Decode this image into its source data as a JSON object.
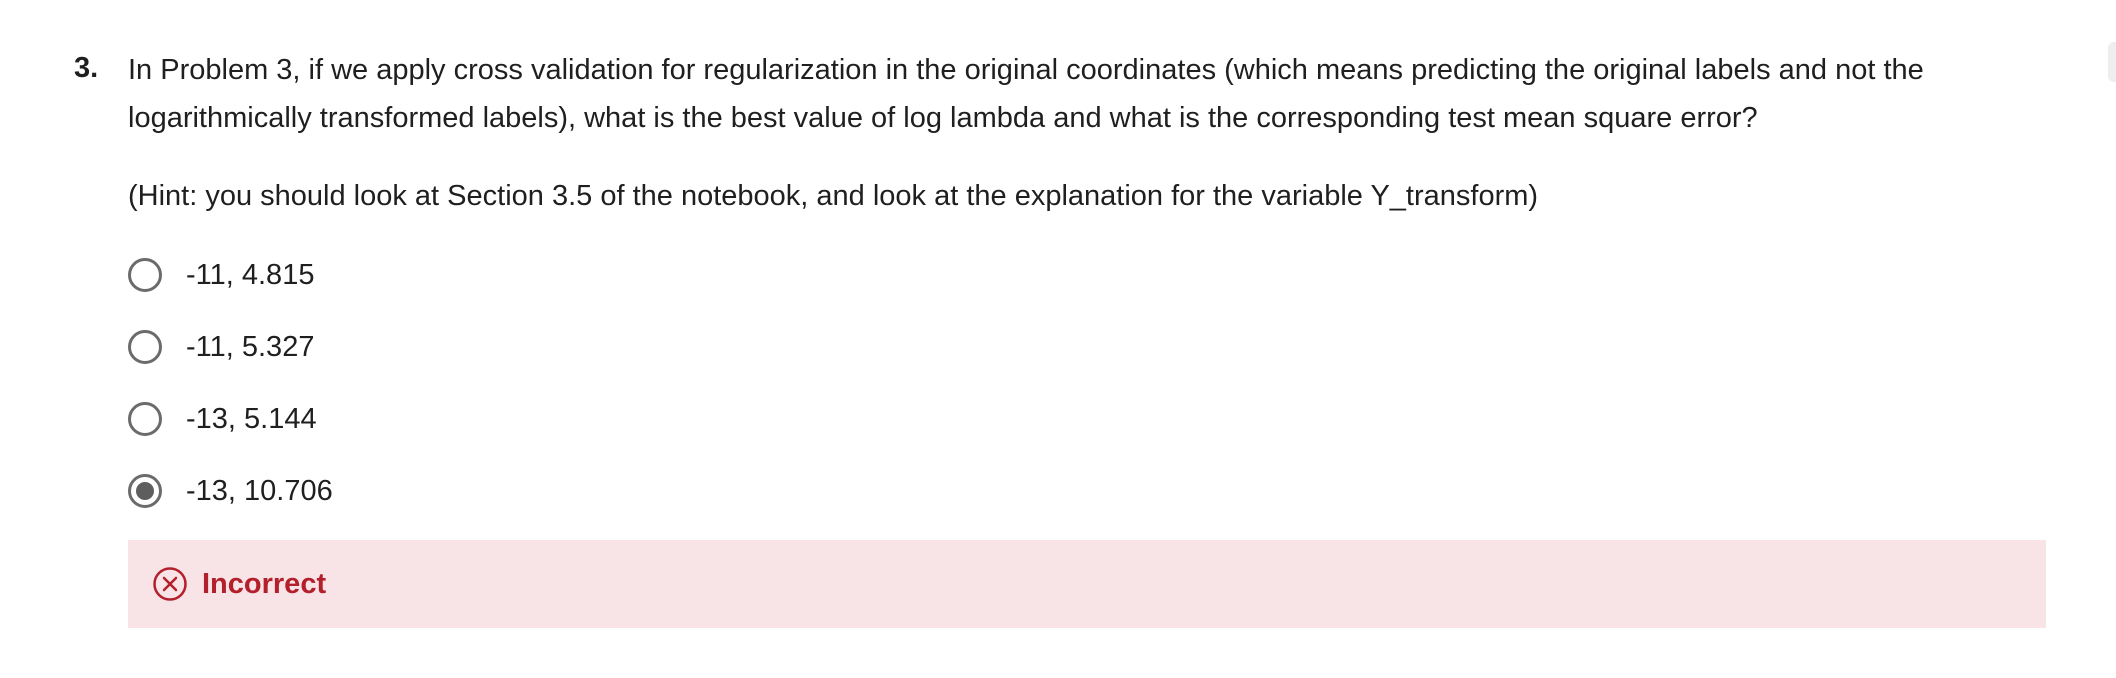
{
  "question": {
    "number": "3.",
    "text": "In Problem 3, if we apply cross validation for regularization in the original coordinates (which means predicting the original labels and not the logarithmically transformed labels), what is the best value of log lambda and what is the corresponding test mean square error?",
    "hint": "(Hint: you should look at Section 3.5 of the notebook, and look at the explanation for the variable Y_transform)",
    "options": [
      {
        "label": "-11, 4.815",
        "selected": false
      },
      {
        "label": "-11, 5.327",
        "selected": false
      },
      {
        "label": "-13, 5.144",
        "selected": false
      },
      {
        "label": "-13, 10.706",
        "selected": true
      }
    ]
  },
  "feedback": {
    "status": "Incorrect",
    "icon": "x-circle-icon",
    "color": "#b3202c",
    "background": "#f8e3e6"
  }
}
